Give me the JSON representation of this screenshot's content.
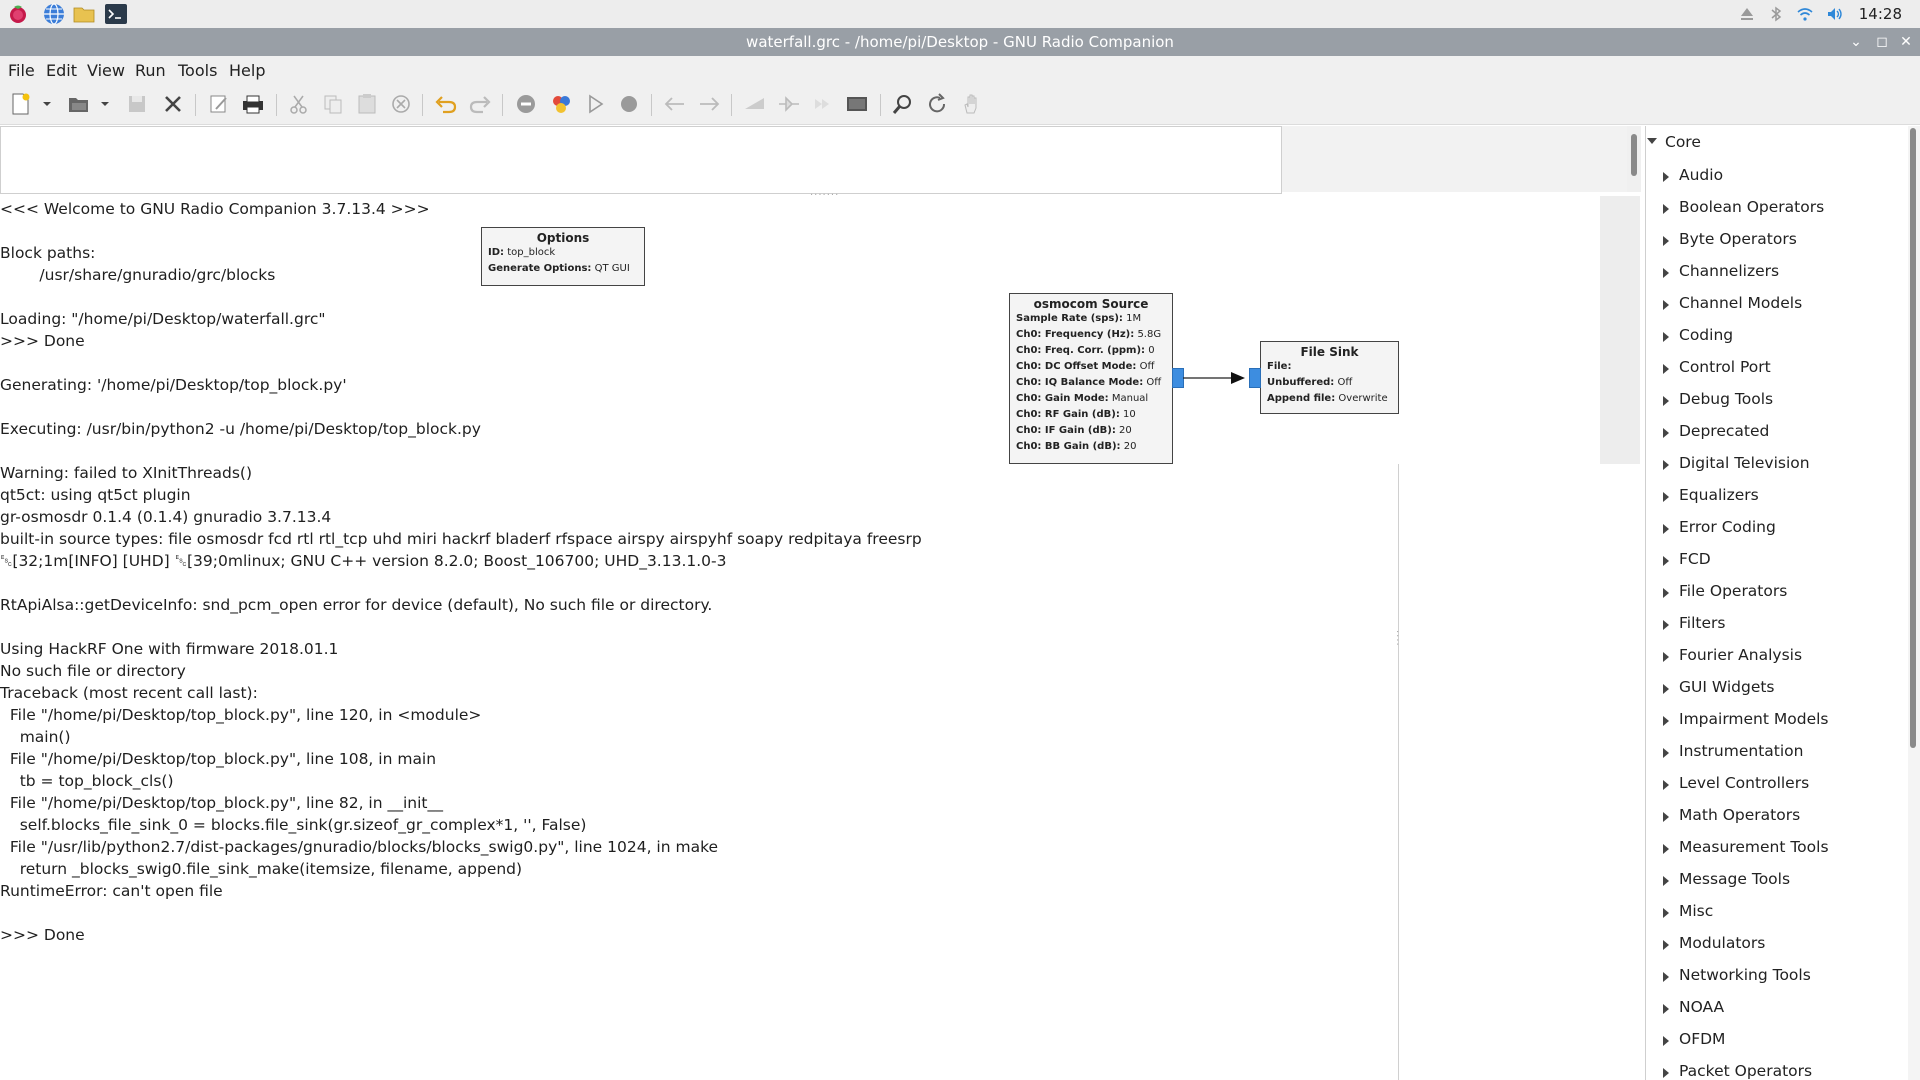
{
  "taskbar": {
    "launchers": [
      "raspberry-menu-icon",
      "web-browser-icon",
      "file-manager-icon",
      "terminal-icon"
    ],
    "tray_icons": [
      "eject-icon",
      "bluetooth-icon",
      "wifi-icon",
      "volume-icon"
    ],
    "clock": "14:28"
  },
  "window": {
    "title": "waterfall.grc - /home/pi/Desktop - GNU Radio Companion",
    "controls": [
      "minimize-icon",
      "maximize-icon",
      "close-icon"
    ]
  },
  "menu": [
    "File",
    "Edit",
    "View",
    "Run",
    "Tools",
    "Help"
  ],
  "toolbar": {
    "icons": [
      "new-icon",
      "new-dropdown-icon",
      "open-icon",
      "open-dropdown-icon",
      "save-icon",
      "close-file-icon",
      "edit-icon",
      "print-icon",
      "cut-icon",
      "copy-icon",
      "paste-icon",
      "delete-icon",
      "undo-icon",
      "redo-icon",
      "disable-icon",
      "generate-icon",
      "execute-icon",
      "kill-icon",
      "rotate-left-icon",
      "rotate-right-icon",
      "enable-icon",
      "bypass-icon",
      "forward-icon",
      "screenshot-icon",
      "find-icon",
      "reload-icon",
      "hand-icon"
    ]
  },
  "console": {
    "lines": [
      "<<< Welcome to GNU Radio Companion 3.7.13.4 >>>",
      "",
      "Block paths:",
      "        /usr/share/gnuradio/grc/blocks",
      "",
      "Loading: \"/home/pi/Desktop/waterfall.grc\"",
      ">>> Done",
      "",
      "Generating: '/home/pi/Desktop/top_block.py'",
      "",
      "Executing: /usr/bin/python2 -u /home/pi/Desktop/top_block.py",
      "",
      "Warning: failed to XInitThreads()",
      "qt5ct: using qt5ct plugin",
      "gr-osmosdr 0.1.4 (0.1.4) gnuradio 3.7.13.4",
      "built-in source types: file osmosdr fcd rtl rtl_tcp uhd miri hackrf bladerf rfspace airspy airspyhf soapy redpitaya freesrp",
      "␛[32;1m[INFO] [UHD] ␛[39;0mlinux; GNU C++ version 8.2.0; Boost_106700; UHD_3.13.1.0-3",
      "",
      "RtApiAlsa::getDeviceInfo: snd_pcm_open error for device (default), No such file or directory.",
      "",
      "Using HackRF One with firmware 2018.01.1",
      "No such file or directory",
      "Traceback (most recent call last):",
      "  File \"/home/pi/Desktop/top_block.py\", line 120, in <module>",
      "    main()",
      "  File \"/home/pi/Desktop/top_block.py\", line 108, in main",
      "    tb = top_block_cls()",
      "  File \"/home/pi/Desktop/top_block.py\", line 82, in __init__",
      "    self.blocks_file_sink_0 = blocks.file_sink(gr.sizeof_gr_complex*1, '', False)",
      "  File \"/usr/lib/python2.7/dist-packages/gnuradio/blocks/blocks_swig0.py\", line 1024, in make",
      "    return _blocks_swig0.file_sink_make(itemsize, filename, append)",
      "RuntimeError: can't open file",
      "",
      ">>> Done"
    ]
  },
  "blocks": {
    "options": {
      "title": "Options",
      "rows": [
        [
          "ID:",
          "top_block"
        ],
        [
          "Generate Options:",
          "QT GUI"
        ]
      ]
    },
    "osmocom": {
      "title": "osmocom Source",
      "rows": [
        [
          "Sample Rate (sps):",
          "1M"
        ],
        [
          "Ch0: Frequency (Hz):",
          "5.8G"
        ],
        [
          "Ch0: Freq. Corr. (ppm):",
          "0"
        ],
        [
          "Ch0: DC Offset Mode:",
          "Off"
        ],
        [
          "Ch0: IQ Balance Mode:",
          "Off"
        ],
        [
          "Ch0: Gain Mode:",
          "Manual"
        ],
        [
          "Ch0: RF Gain (dB):",
          "10"
        ],
        [
          "Ch0: IF Gain (dB):",
          "20"
        ],
        [
          "Ch0: BB Gain (dB):",
          "20"
        ]
      ]
    },
    "filesink": {
      "title": "File Sink",
      "rows": [
        [
          "File:",
          ""
        ],
        [
          "Unbuffered:",
          "Off"
        ],
        [
          "Append file:",
          "Overwrite"
        ]
      ]
    }
  },
  "library": {
    "root": "Core",
    "categories": [
      "Audio",
      "Boolean Operators",
      "Byte Operators",
      "Channelizers",
      "Channel Models",
      "Coding",
      "Control Port",
      "Debug Tools",
      "Deprecated",
      "Digital Television",
      "Equalizers",
      "Error Coding",
      "FCD",
      "File Operators",
      "Filters",
      "Fourier Analysis",
      "GUI Widgets",
      "Impairment Models",
      "Instrumentation",
      "Level Controllers",
      "Math Operators",
      "Measurement Tools",
      "Message Tools",
      "Misc",
      "Modulators",
      "Networking Tools",
      "NOAA",
      "OFDM",
      "Packet Operators"
    ]
  }
}
